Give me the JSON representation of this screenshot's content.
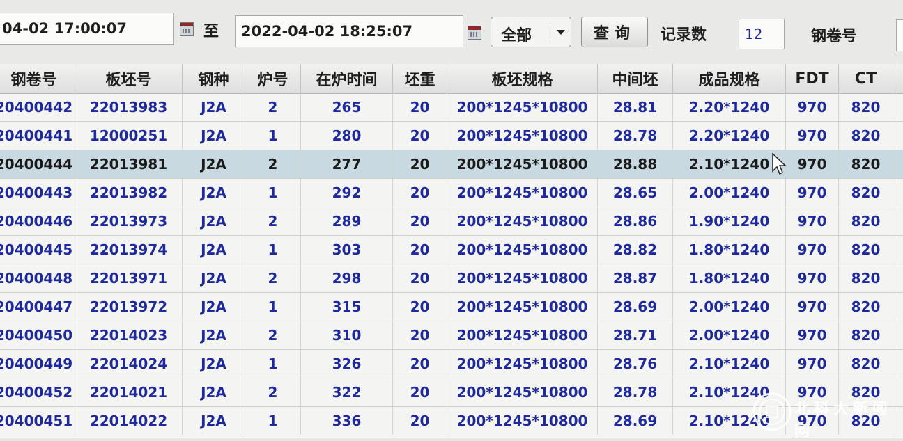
{
  "toolbar": {
    "start_time": "04-02 17:00:07",
    "to_label": "至",
    "end_time": "2022-04-02 18:25:07",
    "filter_value": "全部",
    "query_label": "查询",
    "record_count_label": "记录数",
    "record_count_value": "12",
    "coil_no_label": "钢卷号"
  },
  "table": {
    "columns": [
      "钢卷号",
      "板坯号",
      "钢种",
      "炉号",
      "在炉时间",
      "坯重",
      "板坯规格",
      "中间坯",
      "成品规格",
      "FDT",
      "CT"
    ],
    "selected_row": 2,
    "rows": [
      [
        "20400442",
        "22013983",
        "J2A",
        "2",
        "265",
        "20",
        "200*1245*10800",
        "28.81",
        "2.20*1240",
        "970",
        "820"
      ],
      [
        "20400441",
        "12000251",
        "J2A",
        "1",
        "280",
        "20",
        "200*1245*10800",
        "28.78",
        "2.20*1240",
        "970",
        "820"
      ],
      [
        "20400444",
        "22013981",
        "J2A",
        "2",
        "277",
        "20",
        "200*1245*10800",
        "28.88",
        "2.10*1240",
        "970",
        "820"
      ],
      [
        "20400443",
        "22013982",
        "J2A",
        "1",
        "292",
        "20",
        "200*1245*10800",
        "28.65",
        "2.00*1240",
        "970",
        "820"
      ],
      [
        "20400446",
        "22013973",
        "J2A",
        "2",
        "289",
        "20",
        "200*1245*10800",
        "28.86",
        "1.90*1240",
        "970",
        "820"
      ],
      [
        "20400445",
        "22013974",
        "J2A",
        "1",
        "303",
        "20",
        "200*1245*10800",
        "28.82",
        "1.80*1240",
        "970",
        "820"
      ],
      [
        "20400448",
        "22013971",
        "J2A",
        "2",
        "298",
        "20",
        "200*1245*10800",
        "28.87",
        "1.80*1240",
        "970",
        "820"
      ],
      [
        "20400447",
        "22013972",
        "J2A",
        "1",
        "315",
        "20",
        "200*1245*10800",
        "28.69",
        "2.00*1240",
        "970",
        "820"
      ],
      [
        "20400450",
        "22014023",
        "J2A",
        "2",
        "310",
        "20",
        "200*1245*10800",
        "28.71",
        "2.00*1240",
        "970",
        "820"
      ],
      [
        "20400449",
        "22014024",
        "J2A",
        "1",
        "326",
        "20",
        "200*1245*10800",
        "28.76",
        "2.10*1240",
        "970",
        "820"
      ],
      [
        "20400452",
        "22014021",
        "J2A",
        "2",
        "322",
        "20",
        "200*1245*10800",
        "28.78",
        "2.10*1240",
        "970",
        "820"
      ],
      [
        "20400451",
        "22014022",
        "J2A",
        "1",
        "336",
        "20",
        "200*1245*10800",
        "28.69",
        "2.10*1240",
        "970",
        "820"
      ]
    ]
  },
  "watermark": {
    "name": "北科大新闻网"
  },
  "colors": {
    "cell_text": "#1f2a9a",
    "selected_row": "#c9d9e2",
    "header_bg": "#e6e6e4"
  }
}
